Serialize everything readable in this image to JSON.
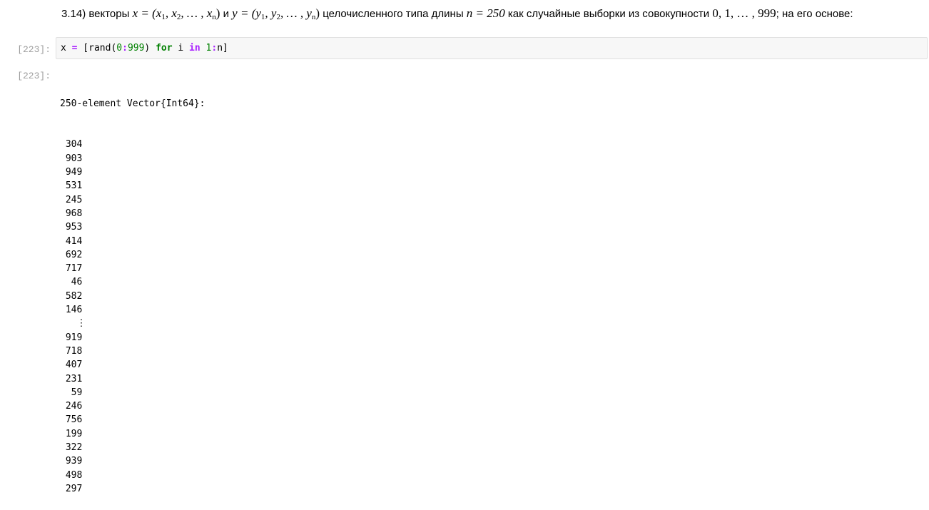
{
  "markdown": {
    "prefix": "3.14) векторы ",
    "x_eq": "x = (x",
    "x_mid": ", x",
    "x_tail": ", … , x",
    "sub1": "1",
    "sub2": "2",
    "subn": "n",
    "close": ")",
    "and": " и ",
    "y_eq": "y = (y",
    "y_mid": ", y",
    "y_tail": ", … , y",
    "middle": " целочисленного типа длины ",
    "n_eq": "n = 250",
    "like": " как случайные выборки из совокупности ",
    "set": "0, 1, … , 999",
    "suffix": "; на его основе:"
  },
  "input_cell": {
    "prompt": "[223]:",
    "code_parts": {
      "var": "x ",
      "assign": "=",
      "open": " [rand(",
      "zero": "0",
      "colon1": ":",
      "nine99": "999",
      "close_paren": ") ",
      "for": "for",
      "i": " i ",
      "in": "in",
      "sp": " ",
      "one": "1",
      "colon2": ":",
      "n_close": "n]"
    }
  },
  "output_cell": {
    "prompt": "[223]:",
    "header": "250-element Vector{Int64}:",
    "values": [
      " 304",
      " 903",
      " 949",
      " 531",
      " 245",
      " 968",
      " 953",
      " 414",
      " 692",
      " 717",
      "  46",
      " 582",
      " 146",
      "   ⋮",
      " 919",
      " 718",
      " 407",
      " 231",
      "  59",
      " 246",
      " 756",
      " 199",
      " 322",
      " 939",
      " 498",
      " 297"
    ]
  }
}
